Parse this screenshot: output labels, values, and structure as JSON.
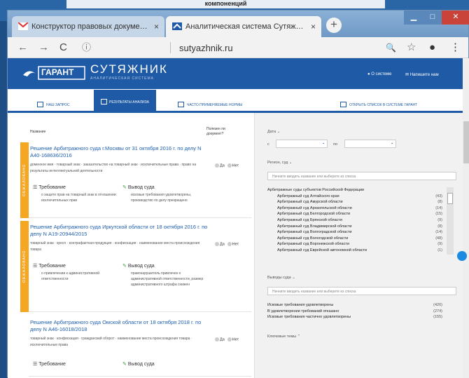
{
  "top_caption": "компоненций",
  "browser": {
    "tabs": [
      {
        "title": "Конструктор правовых докуме…",
        "close": "×"
      },
      {
        "title": "Аналитическая система Сутяж…",
        "close": "×"
      }
    ],
    "new_tab": "+",
    "url": "sutyazhnik.ru",
    "nav": {
      "back": "←",
      "forward": "→",
      "reload": "C",
      "info": "ⓘ"
    },
    "tools": {
      "zoom": "🔍",
      "star": "☆",
      "account": "●",
      "menu": "⋮"
    },
    "window": {
      "min": "▁",
      "max": "□",
      "close": "✕"
    }
  },
  "app": {
    "logo": "ГАРАНТ",
    "brand": "СУТЯЖНИК",
    "brand_sub": "АНАЛИТИЧЕСКАЯ СИСТЕМА",
    "about": "О системе",
    "write": "Напишите нам",
    "subnav": [
      "НАШ ЗАПРОС",
      "РЕЗУЛЬТАТЫ АНАЛИЗА",
      "ЧАСТО ПРИМЕНЯЕМЫЕ НОРМЫ",
      "ОТКРЫТЬ СПИСОК В СИСТЕМЕ ГАРАНТ"
    ]
  },
  "results": {
    "col_name": "Название",
    "col_useful": "Полезен ли документ?",
    "yes": "Да",
    "no": "Нет",
    "cards": [
      {
        "stripe": "ОБЖАЛОВАНО",
        "title": "Решение Арбитражного суда г.Москвы от 31 октября 2016 г. по делу N А40-168636/2016",
        "tags": "доменное имя · товарный знак · заказательство на товарный знак · исключительные права · право на результаты интеллектуальной деятельности",
        "req_h": "Требование",
        "req": "о защите прав на товарный знак в отношении исключительных прав",
        "out_h": "Вывод суда",
        "out": "исковые требования удовлетворены, производство по делу прекращено"
      },
      {
        "stripe": "ОБЖАЛОВАНО",
        "title": "Решение Арбитражного суда Иркутской области от 18 октября 2016 г. по делу N А19-20944/2015",
        "tags": "товарный знак · кресп · контрафактная продукция · конфискация · наименование места происхождения товара",
        "req_h": "Требование",
        "req": "о привлечении к административной ответственности",
        "out_h": "Вывод суда",
        "out": "правонарушитель привлечен к административной ответственности, размер административного штрафа снижен"
      },
      {
        "stripe": "",
        "title": "Решение Арбитражного суда Омской области от 18 октября 2018 г. по делу N А46-16018/2018",
        "tags": "товарный знак · конфискация · гражданский оборот · наименование места происхождения товара · исключительные права",
        "req_h": "Требование",
        "req": "",
        "out_h": "Вывод суда",
        "out": ""
      }
    ]
  },
  "filters": {
    "date": "Дата",
    "from": "с",
    "to": "по",
    "courts_region": "Регион, суд",
    "search_placeholder": "Начните вводить название или выберите из списка",
    "courts": [
      {
        "name": "Арбитражные суды субъектов Российской Федерации",
        "count": ""
      },
      {
        "name": "Арбитражный суд Алтайского края",
        "count": "(43)"
      },
      {
        "name": "Арбитражный суд Амурской области",
        "count": "(8)"
      },
      {
        "name": "Арбитражный суд Архангельской области",
        "count": "(14)"
      },
      {
        "name": "Арбитражный суд Белгородской области",
        "count": "(15)"
      },
      {
        "name": "Арбитражный суд Брянской области",
        "count": "(9)"
      },
      {
        "name": "Арбитражный суд Владимирской области",
        "count": "(8)"
      },
      {
        "name": "Арбитражный суд Волгоградской области",
        "count": "(14)"
      },
      {
        "name": "Арбитражный суд Вологодской области",
        "count": "(48)"
      },
      {
        "name": "Арбитражный суд Воронежской области",
        "count": "(9)"
      },
      {
        "name": "Арбитражный суд Еврейской автономной области",
        "count": "(1)"
      }
    ],
    "outcomes_label": "Выводы суда",
    "outcomes": [
      {
        "name": "Исковые требования удовлетворены",
        "count": "(426)"
      },
      {
        "name": "В удовлетворении требований отказано",
        "count": "(274)"
      },
      {
        "name": "Исковые требования частично удовлетворены",
        "count": "(155)"
      }
    ],
    "keywords": "Ключевые темы"
  },
  "colors": {
    "brand": "#1e5aa5",
    "stripe": "#f5a623",
    "link": "#2060b0"
  }
}
